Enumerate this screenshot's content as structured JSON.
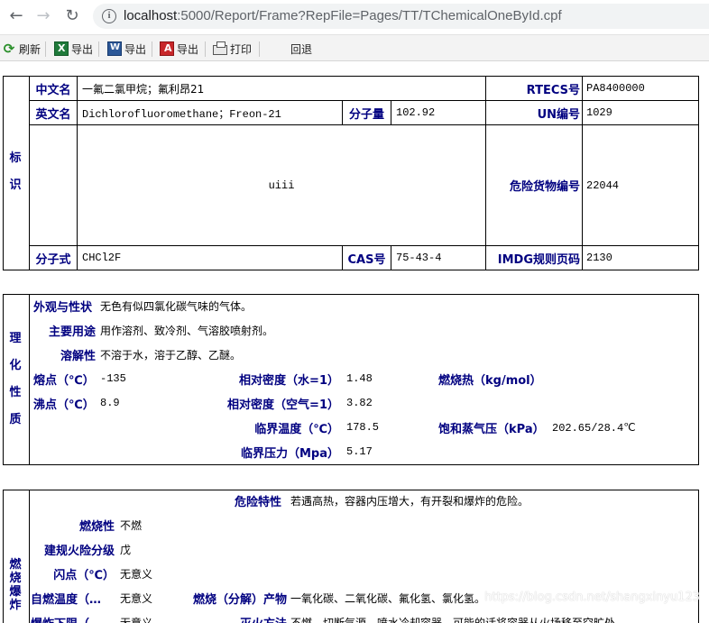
{
  "browser": {
    "back_icon": "arrow-left-icon",
    "forward_icon": "arrow-right-icon",
    "reload_icon": "reload-icon",
    "url_host": "localhost",
    "url_rest": ":5000/Report/Frame?RepFile=Pages/TT/TChemicalOneById.cpf"
  },
  "toolbar": {
    "refresh": "刷新",
    "export_excel": "导出",
    "export_word": "导出",
    "export_pdf": "导出",
    "print": "打印",
    "back": "回退"
  },
  "identity": {
    "section_label": [
      "标",
      "识"
    ],
    "cn_name_label": "中文名",
    "cn_name": "一氟二氯甲烷；氟利昂21",
    "rtecs_label": "RTECS号",
    "rtecs": "PA8400000",
    "en_name_label": "英文名",
    "en_name": "Dichlorofluoromethane；Freon-21",
    "mw_label": "分子量",
    "mw": "102.92",
    "un_label": "UN编号",
    "un": "1029",
    "structure": "uiii",
    "dg_label": "危险货物编号",
    "dg": "22044",
    "formula_label": "分子式",
    "formula": "CHCl2F",
    "cas_label": "CAS号",
    "cas": "75-43-4",
    "imdg_label": "IMDG规则页码",
    "imdg": "2130"
  },
  "physchem": {
    "section_label": [
      "理",
      "化",
      "性",
      "质"
    ],
    "appearance_label": "外观与性状",
    "appearance": "无色有似四氯化碳气味的气体。",
    "use_label": "主要用途",
    "use": "用作溶剂、致冷剂、气溶胶喷射剂。",
    "solubility_label": "溶解性",
    "solubility": "不溶于水，溶于乙醇、乙醚。",
    "mp_label": "熔点（℃）",
    "mp": "-135",
    "rd_water_label": "相对密度（水=1）",
    "rd_water": "1.48",
    "heat_label": "燃烧热（kg/mol）",
    "heat": "",
    "bp_label": "沸点（℃）",
    "bp": "8.9",
    "rd_air_label": "相对密度（空气=1）",
    "rd_air": "3.82",
    "ct_label": "临界温度（℃）",
    "ct": "178.5",
    "vp_label": "饱和蒸气压（kPa）",
    "vp": "202.65/28.4℃",
    "cp_label": "临界压力（Mpa）",
    "cp": "5.17"
  },
  "fire": {
    "section_label": [
      "燃",
      "烧",
      "爆",
      "炸"
    ],
    "hazard_label": "危险特性",
    "hazard": "若遇高热，容器内压增大，有开裂和爆炸的危险。",
    "flammability_label": "燃烧性",
    "flammability": "不燃",
    "class_label": "建规火险分级",
    "class": "戊",
    "flash_label": "闪点（℃）",
    "flash": "无意义",
    "autoign_label": "自燃温度（…",
    "autoign": "无意义",
    "products_label": "燃烧（分解）产物",
    "products": "一氧化碳、二氧化碳、氟化氢、氯化氢。",
    "lower_label": "爆炸下限（…",
    "lower": "无意义",
    "extinguish_label": "灭火方法",
    "extinguish": "不燃。切断气源。喷水冷却容器，可能的话将容器从火场移至空旷处。"
  },
  "watermark": "https://blog.csdn.net/shangxinyu123"
}
